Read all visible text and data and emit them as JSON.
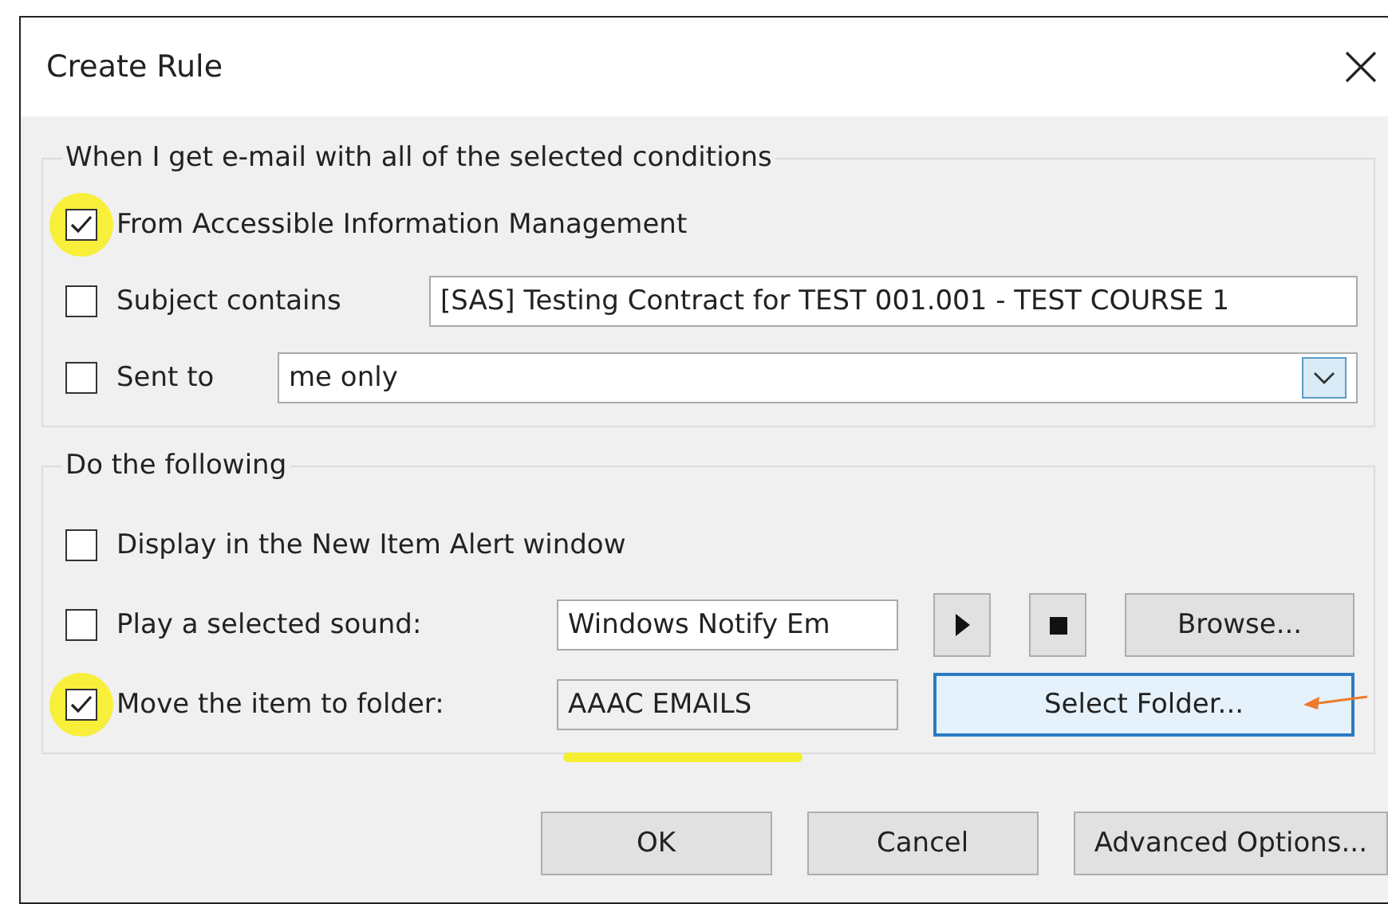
{
  "window": {
    "title": "Create Rule"
  },
  "conditions": {
    "title": "When I get e-mail with all of the selected conditions",
    "rows": [
      {
        "kind": "plain",
        "label": "From Accessible Information Management",
        "checked": true,
        "annotated": true
      },
      {
        "kind": "text",
        "label": "Subject contains",
        "checked": false,
        "annotated": false,
        "value": "[SAS] Testing Contract for TEST 001.001 - TEST COURSE 1"
      },
      {
        "kind": "dropdown",
        "label": "Sent to",
        "checked": false,
        "annotated": false,
        "value": "me only"
      }
    ]
  },
  "actions": {
    "title": "Do the following",
    "rows": [
      {
        "kind": "plain",
        "label": "Display in the New Item Alert window",
        "checked": false,
        "annotated": false
      },
      {
        "kind": "sound",
        "label": "Play a selected sound:",
        "checked": false,
        "annotated": false,
        "value": "Windows Notify Em",
        "button": "Browse..."
      },
      {
        "kind": "folder",
        "label": "Move the item to folder:",
        "checked": true,
        "annotated": true,
        "value": "AAAC EMAILS",
        "button": "Select Folder..."
      }
    ]
  },
  "buttons": [
    {
      "label": "OK"
    },
    {
      "label": "Cancel"
    },
    {
      "label": "Advanced Options..."
    }
  ]
}
